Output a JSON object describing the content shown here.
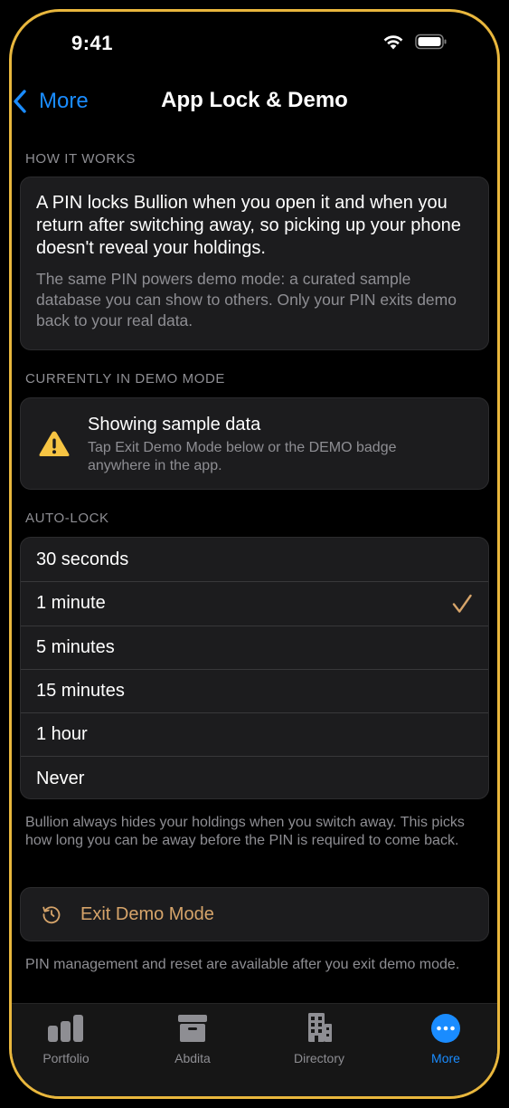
{
  "status_bar": {
    "time": "9:41"
  },
  "nav": {
    "back_label": "More",
    "title": "App Lock & Demo"
  },
  "how_it_works": {
    "header": "HOW IT WORKS",
    "main_text": "A PIN locks Bullion when you open it and when you return after switching away, so picking up your phone doesn't reveal your holdings.",
    "sub_text": "The same PIN powers demo mode: a curated sample database you can show to others. Only your PIN exits demo back to your real data."
  },
  "demo_mode": {
    "header": "CURRENTLY IN DEMO MODE",
    "title": "Showing sample data",
    "description": "Tap Exit Demo Mode below or the DEMO badge anywhere in the app.",
    "icon": "warning-icon"
  },
  "auto_lock": {
    "header": "AUTO-LOCK",
    "options": [
      "30 seconds",
      "1 minute",
      "5 minutes",
      "15 minutes",
      "1 hour",
      "Never"
    ],
    "selected": "1 minute",
    "footer": "Bullion always hides your holdings when you switch away. This picks how long you can be away before the PIN is required to come back."
  },
  "exit_demo": {
    "label": "Exit Demo Mode",
    "icon": "restore-icon"
  },
  "pin_footer": "PIN management and reset are available after you exit demo mode.",
  "tab_bar": {
    "tabs": [
      {
        "label": "Portfolio",
        "icon": "bar-chart-icon"
      },
      {
        "label": "Abdita",
        "icon": "archive-box-icon"
      },
      {
        "label": "Directory",
        "icon": "building-icon"
      },
      {
        "label": "More",
        "icon": "ellipsis-circle-icon"
      }
    ],
    "active": "More"
  },
  "colors": {
    "accent": "#1a8cff",
    "warning": "#f6c443",
    "demo_action": "#d6a46a",
    "frame": "#e9b73d"
  }
}
